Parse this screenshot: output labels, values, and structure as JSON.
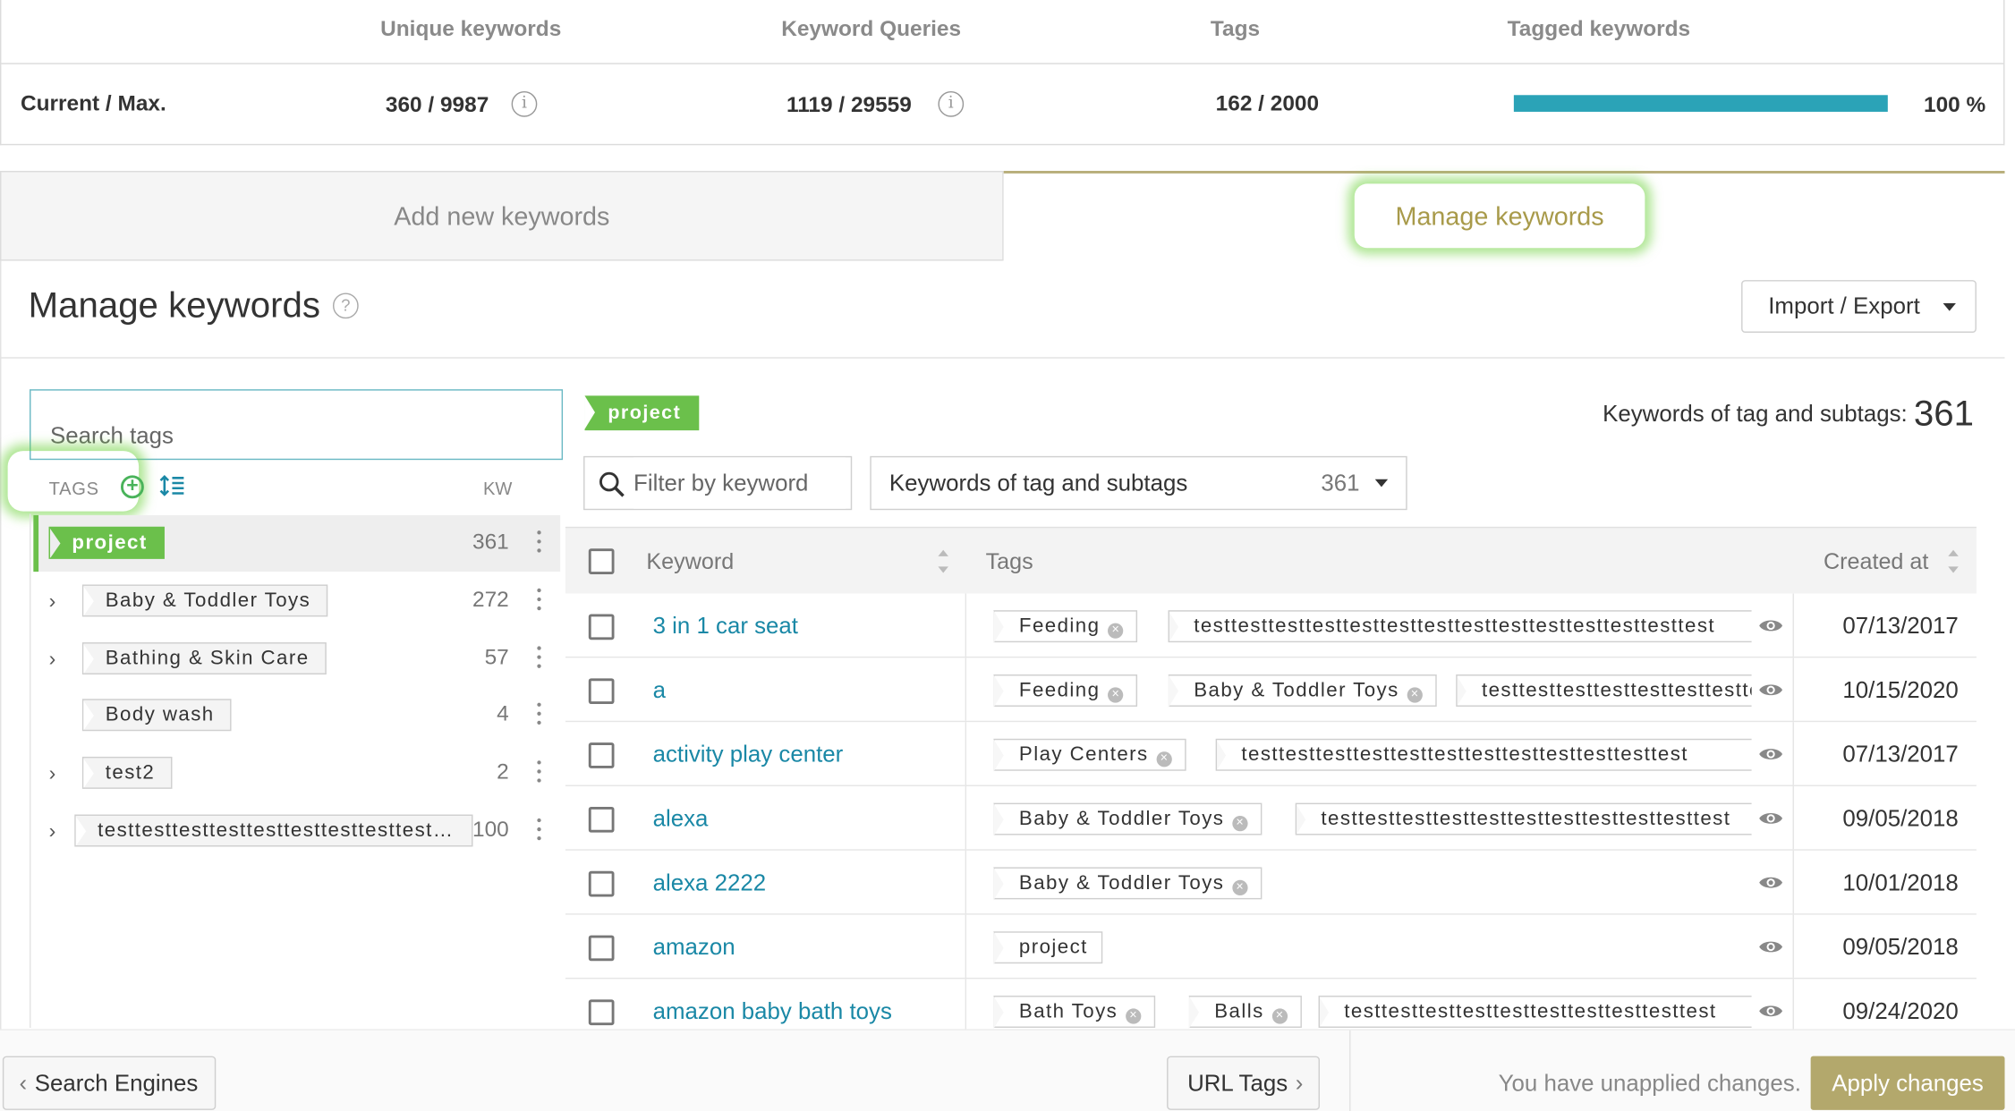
{
  "stats": {
    "headers": [
      "Unique keywords",
      "Keyword Queries",
      "Tags",
      "Tagged keywords"
    ],
    "row_label": "Current / Max.",
    "unique_keywords": "360 / 9987",
    "keyword_queries": "1119 / 29559",
    "tags": "162 / 2000",
    "tagged_keywords_percent": 100,
    "tagged_keywords_label": "100 %",
    "info_glyph": "i"
  },
  "tabs": {
    "add": "Add new keywords",
    "manage": "Manage keywords"
  },
  "header": {
    "title": "Manage keywords",
    "help_glyph": "?",
    "import_export": "Import / Export"
  },
  "tag_panel": {
    "search_placeholder": "Search tags",
    "tags_label": "TAGS",
    "add_glyph": "+",
    "kw_label": "KW",
    "items": [
      {
        "name": "project",
        "count": "361",
        "expandable": false,
        "active": true
      },
      {
        "name": "Baby & Toddler Toys",
        "count": "272",
        "expandable": true,
        "active": false
      },
      {
        "name": "Bathing & Skin Care",
        "count": "57",
        "expandable": true,
        "active": false
      },
      {
        "name": "Body wash",
        "count": "4",
        "expandable": false,
        "active": false
      },
      {
        "name": "test2",
        "count": "2",
        "expandable": true,
        "active": false
      },
      {
        "name": "testtesttesttesttesttesttesttesttesttesttesttesttest",
        "count": "100",
        "expandable": true,
        "active": false
      }
    ],
    "chevron_glyph": "›"
  },
  "main": {
    "breadcrumb_tag": "project",
    "kw_of_tag_label": "Keywords of tag and subtags:",
    "kw_of_tag_count": "361",
    "filter_placeholder": "Filter by keyword",
    "select_label": "Keywords of tag and subtags",
    "select_count": "361",
    "columns": {
      "keyword": "Keyword",
      "tags": "Tags",
      "created": "Created at"
    },
    "remove_glyph": "×",
    "rows": [
      {
        "keyword": "3 in 1 car seat",
        "tags": [
          {
            "t": "Feeding",
            "x": true
          },
          {
            "t": "testtesttesttesttesttesttesttesttesttesttesttesttesttest",
            "x": false
          }
        ],
        "created": "07/13/2017"
      },
      {
        "keyword": "a",
        "tags": [
          {
            "t": "Feeding",
            "x": true
          },
          {
            "t": "Baby & Toddler Toys",
            "x": true
          },
          {
            "t": "testtesttesttesttesttesttesttest",
            "x": false
          }
        ],
        "created": "10/15/2020"
      },
      {
        "keyword": "activity play center",
        "tags": [
          {
            "t": "Play Centers",
            "x": true
          },
          {
            "t": "testtesttesttesttesttesttesttesttesttesttesttest",
            "x": false
          }
        ],
        "created": "07/13/2017"
      },
      {
        "keyword": "alexa",
        "tags": [
          {
            "t": "Baby & Toddler Toys",
            "x": true
          },
          {
            "t": "testtesttesttesttesttesttesttesttesttesttest",
            "x": false
          }
        ],
        "created": "09/05/2018"
      },
      {
        "keyword": "alexa 2222",
        "tags": [
          {
            "t": "Baby & Toddler Toys",
            "x": true
          }
        ],
        "created": "10/01/2018"
      },
      {
        "keyword": "amazon",
        "tags": [
          {
            "t": "project",
            "x": false
          }
        ],
        "created": "09/05/2018"
      },
      {
        "keyword": "amazon baby bath toys",
        "tags": [
          {
            "t": "Bath Toys",
            "x": true
          },
          {
            "t": "Balls",
            "x": true
          },
          {
            "t": "testtesttesttesttesttesttesttesttesttest",
            "x": false
          }
        ],
        "created": "09/24/2020"
      }
    ]
  },
  "footer": {
    "search_engines": "Search Engines",
    "url_tags": "URL Tags",
    "back_glyph": "‹",
    "forward_glyph": "›",
    "unapplied": "You have unapplied changes.",
    "apply": "Apply changes"
  },
  "colors": {
    "accent_teal": "#2ba3b7",
    "tag_green": "#6bc04b",
    "gold": "#b3a86c",
    "link": "#1a88a6"
  }
}
